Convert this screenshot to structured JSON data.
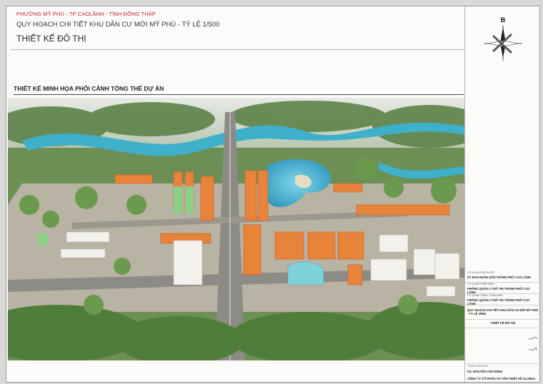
{
  "header": {
    "location": "PHƯỜNG MỸ PHÚ - TP CAOLÃNH - TỈNH ĐỒNG THÁP",
    "project": "QUY HOẠCH CHI TIẾT KHU DÂN CƯ MỚI MỸ PHÚ - TỶ LỆ 1/500",
    "drawing": "THIẾT KẾ ĐÔ THỊ"
  },
  "section": {
    "title": "THIẾT KẾ MINH HỌA PHỐI CẢNH TỔNG THỂ DỰ ÁN"
  },
  "compass": {
    "label": "B"
  },
  "title_block": {
    "approve_caption": "CƠ QUAN PHÊ DUYỆT",
    "approve_org": "ỦY BAN NHÂN DÂN THÀNH PHỐ CAO LÃNH",
    "appraise_caption": "CƠ QUAN THẨM ĐỊNH",
    "appraise_org": "PHÒNG QUẢN LÝ ĐÔ THỊ THÀNH PHỐ CAO LÃNH",
    "submit_caption": "CƠ QUAN TRÌNH THẨM ĐỊNH",
    "submit_org": "PHÒNG QUẢN LÝ ĐÔ THỊ THÀNH PHỐ CAO LÃNH",
    "project_name": "QUY HOẠCH CHI TIẾT KHU DÂN CƯ MỚI MỸ PHÚ - TỶ LỆ 1/500",
    "drawing_name": "THIẾT KẾ ĐÔ THỊ",
    "director_caption": "TỔNG GIÁM ĐỐC",
    "director": "KS. NGUYỄN VĂN DŨNG",
    "company": "CÔNG TY CỔ PHẦN TƯ VẤN THIẾT KẾ GLOBAL"
  },
  "colors": {
    "header_red": "#c3262a",
    "rooftop_orange": "#e8833a",
    "water_blue": "#3fb0c9",
    "greenery": "#4f7d3c"
  }
}
